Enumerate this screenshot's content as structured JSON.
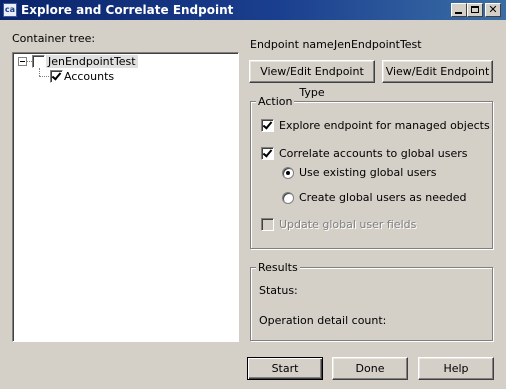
{
  "window": {
    "title": "Explore and Correlate Endpoint",
    "icon": "ca-app-icon",
    "controls": [
      "minimize-icon",
      "maximize-icon",
      "close-icon"
    ]
  },
  "tree": {
    "label": "Container tree:",
    "root": {
      "label": "JenEndpointTest",
      "checked": false,
      "expanded": true
    },
    "children": [
      {
        "label": "Accounts",
        "checked": true
      }
    ]
  },
  "endpoint": {
    "name_label": "Endpoint name:",
    "name_value": "JenEndpointTest",
    "view_type_button": "View/Edit Endpoint Type",
    "view_endpoint_button": "View/Edit Endpoint"
  },
  "action": {
    "legend": "Action",
    "explore_label": "Explore endpoint for managed objects",
    "explore_checked": true,
    "correlate_label": "Correlate accounts to global users",
    "correlate_checked": true,
    "use_existing_label": "Use existing global users",
    "use_existing_selected": true,
    "create_label": "Create global users as needed",
    "create_selected": false,
    "update_label": "Update global user fields",
    "update_checked": false,
    "update_enabled": false
  },
  "results": {
    "legend": "Results",
    "status_label": "Status:",
    "detail_count_label": "Operation detail count:"
  },
  "footer": {
    "start_button": "Start",
    "done_button": "Done",
    "help_button": "Help"
  }
}
